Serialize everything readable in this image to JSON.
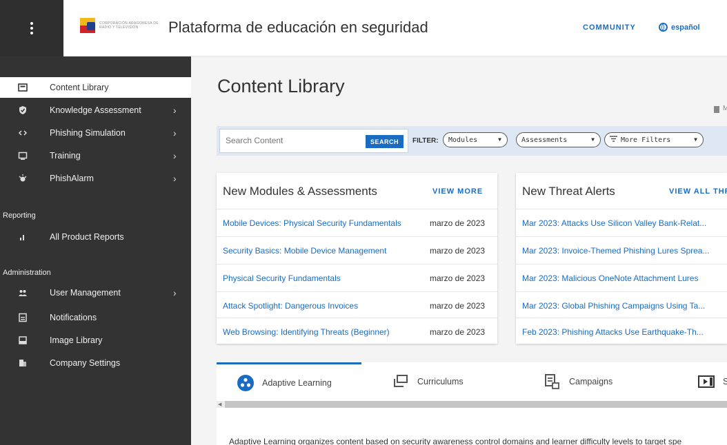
{
  "header": {
    "logo_text": "CORPORACIÓN ARAGONESA DE RADIO Y TELEVISIÓN",
    "app_title": "Plataforma de educación en seguridad",
    "community_label": "COMMUNITY",
    "language_label": "español"
  },
  "sidebar": {
    "items": [
      {
        "label": "Content Library",
        "icon": "library-icon"
      },
      {
        "label": "Knowledge Assessment",
        "icon": "shield-check-icon"
      },
      {
        "label": "Phishing Simulation",
        "icon": "code-icon"
      },
      {
        "label": "Training",
        "icon": "screen-icon"
      },
      {
        "label": "PhishAlarm",
        "icon": "alarm-icon"
      }
    ],
    "reporting_section": "Reporting",
    "reporting_items": [
      {
        "label": "All Product Reports",
        "icon": "bar-chart-icon"
      }
    ],
    "administration_section": "Administration",
    "admin_items": [
      {
        "label": "User Management",
        "icon": "users-icon"
      },
      {
        "label": "Notifications",
        "icon": "notifications-icon"
      },
      {
        "label": "Image Library",
        "icon": "image-icon"
      },
      {
        "label": "Company Settings",
        "icon": "building-icon"
      }
    ]
  },
  "main": {
    "page_title": "Content Library",
    "bookmark_label": "M",
    "search": {
      "placeholder": "Search Content",
      "button_label": "SEARCH"
    },
    "filter_label": "FILTER:",
    "filters": [
      {
        "label": "Modules"
      },
      {
        "label": "Assessments"
      },
      {
        "label": "More Filters"
      }
    ]
  },
  "modules_card": {
    "title": "New Modules & Assessments",
    "link": "VIEW MORE",
    "rows": [
      {
        "title": "Mobile Devices: Physical Security Fundamentals",
        "date": "marzo de 2023"
      },
      {
        "title": "Security Basics: Mobile Device Management",
        "date": "marzo de 2023"
      },
      {
        "title": "Physical Security Fundamentals",
        "date": "marzo de 2023"
      },
      {
        "title": "Attack Spotlight: Dangerous Invoices",
        "date": "marzo de 2023"
      },
      {
        "title": "Web Browsing: Identifying Threats (Beginner)",
        "date": "marzo de 2023"
      }
    ]
  },
  "threats_card": {
    "title": "New Threat Alerts",
    "link": "VIEW ALL THR",
    "rows": [
      {
        "title": "Mar 2023: Attacks Use Silicon Valley Bank-Relat..."
      },
      {
        "title": "Mar 2023: Invoice-Themed Phishing Lures Sprea..."
      },
      {
        "title": "Mar 2023: Malicious OneNote Attachment Lures"
      },
      {
        "title": "Mar 2023: Global Phishing Campaigns Using Ta..."
      },
      {
        "title": "Feb 2023: Phishing Attacks Use Earthquake-Th..."
      }
    ]
  },
  "tabs": [
    {
      "label": "Adaptive Learning"
    },
    {
      "label": "Curriculums"
    },
    {
      "label": "Campaigns"
    },
    {
      "label": "S"
    }
  ],
  "description": "Adaptive Learning organizes content based on security awareness control domains and learner difficulty levels to target spe",
  "colors": {
    "accent": "#1a6cc2",
    "sidebar": "#333333",
    "filter_bar": "#dde8f4"
  }
}
